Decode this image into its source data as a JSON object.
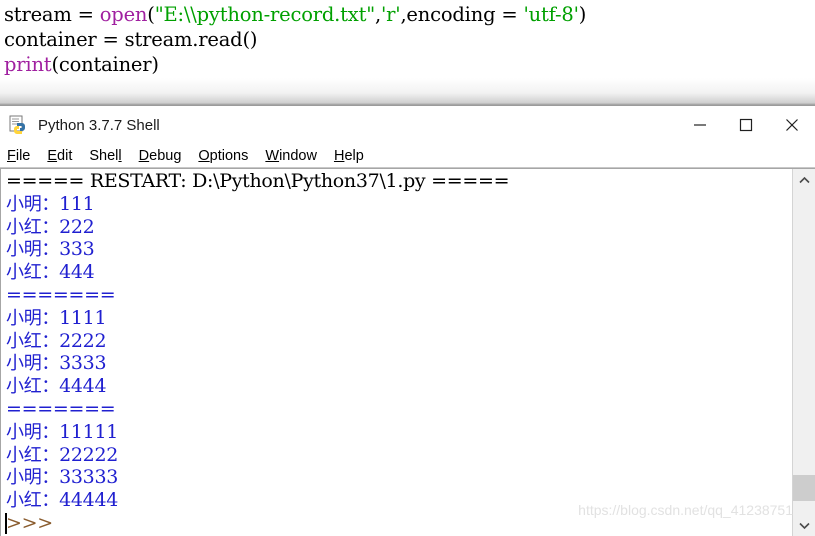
{
  "code_editor": {
    "lines": [
      [
        {
          "text": "stream = ",
          "type": "plain"
        },
        {
          "text": "open",
          "type": "builtin"
        },
        {
          "text": "(",
          "type": "plain"
        },
        {
          "text": "\"E:\\\\python-record.txt\"",
          "type": "string"
        },
        {
          "text": ",",
          "type": "plain"
        },
        {
          "text": "'r'",
          "type": "string"
        },
        {
          "text": ",encoding = ",
          "type": "plain"
        },
        {
          "text": "'utf-8'",
          "type": "string"
        },
        {
          "text": ")",
          "type": "plain"
        }
      ],
      [
        {
          "text": "container = stream.read()",
          "type": "plain"
        }
      ],
      [
        {
          "text": "print",
          "type": "builtin"
        },
        {
          "text": "(container)",
          "type": "plain"
        }
      ]
    ]
  },
  "shell_window": {
    "title": "Python 3.7.7 Shell",
    "icon": "python-idle-icon",
    "window_controls": [
      {
        "name": "minimize-button",
        "glyph": "minimize-icon"
      },
      {
        "name": "maximize-button",
        "glyph": "maximize-icon"
      },
      {
        "name": "close-button",
        "glyph": "close-icon"
      }
    ],
    "menu": [
      {
        "label": "File",
        "mnemonic_index": 0
      },
      {
        "label": "Edit",
        "mnemonic_index": 0
      },
      {
        "label": "Shell",
        "mnemonic_index": 4
      },
      {
        "label": "Debug",
        "mnemonic_index": 0
      },
      {
        "label": "Options",
        "mnemonic_index": 0
      },
      {
        "label": "Window",
        "mnemonic_index": 0
      },
      {
        "label": "Help",
        "mnemonic_index": 0
      }
    ],
    "output_lines": [
      {
        "text": "===== RESTART: D:\\Python\\Python37\\1.py =====",
        "color": "black"
      },
      {
        "text": "小明：111",
        "color": "blue"
      },
      {
        "text": "小红：222",
        "color": "blue"
      },
      {
        "text": "小明：333",
        "color": "blue"
      },
      {
        "text": "小红：444",
        "color": "blue"
      },
      {
        "text": "=======",
        "color": "blue"
      },
      {
        "text": "小明：1111",
        "color": "blue"
      },
      {
        "text": "小红：2222",
        "color": "blue"
      },
      {
        "text": "小明：3333",
        "color": "blue"
      },
      {
        "text": "小红：4444",
        "color": "blue"
      },
      {
        "text": "=======",
        "color": "blue"
      },
      {
        "text": "小明：11111",
        "color": "blue"
      },
      {
        "text": "小红：22222",
        "color": "blue"
      },
      {
        "text": "小明：33333",
        "color": "blue"
      },
      {
        "text": "小红：44444",
        "color": "blue"
      },
      {
        "text": ">>> ",
        "color": "prompt"
      }
    ],
    "scrollbar": {
      "up_arrow": "chevron-up-icon",
      "down_arrow": "chevron-down-icon",
      "thumb_top_pct": 88,
      "thumb_height_pct": 8
    }
  },
  "watermark": {
    "text": "https://blog.csdn.net/qq_41238751"
  },
  "colors": {
    "builtin": "#a020a0",
    "string": "#00a000",
    "output_blue": "#2020d0",
    "prompt": "#8a5c2e",
    "window_bg": "#ffffff"
  }
}
